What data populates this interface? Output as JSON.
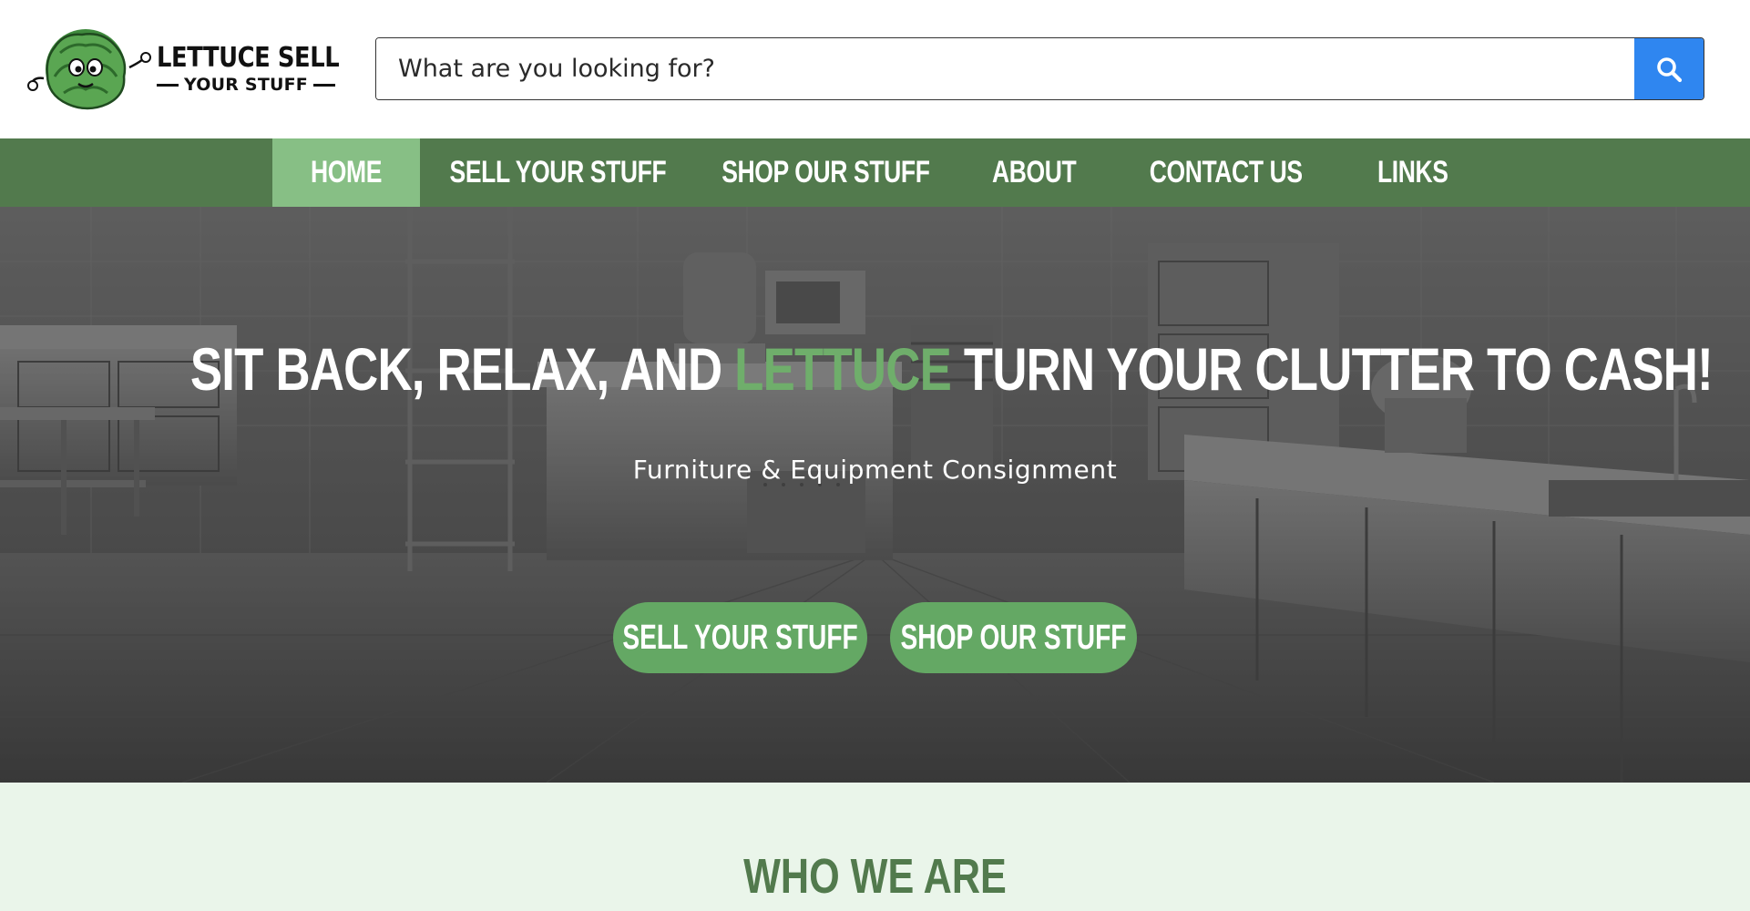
{
  "brand": {
    "name_line1": "LETTUCE SELL",
    "name_line2": "YOUR STUFF",
    "accent_green": "#527a4d",
    "light_green": "#87bf85",
    "button_green": "#64a864",
    "search_blue": "#2f86f0"
  },
  "search": {
    "placeholder": "What are you looking for?",
    "button_icon": "search-icon"
  },
  "nav": {
    "items": [
      {
        "label": "HOME",
        "active": true
      },
      {
        "label": "SELL YOUR STUFF",
        "active": false
      },
      {
        "label": "SHOP OUR STUFF",
        "active": false
      },
      {
        "label": "ABOUT",
        "active": false
      },
      {
        "label": "CONTACT US",
        "active": false
      },
      {
        "label": "LINKS",
        "active": false
      }
    ]
  },
  "hero": {
    "title_before": "SIT BACK, RELAX, AND ",
    "title_accent": "LETTUCE",
    "title_after": " TURN YOUR CLUTTER TO CASH!",
    "subtitle": "Furniture & Equipment Consignment",
    "buttons": {
      "sell": "SELL YOUR STUFF",
      "shop": "SHOP OUR STUFF"
    }
  },
  "section": {
    "who_title": "WHO WE ARE"
  }
}
